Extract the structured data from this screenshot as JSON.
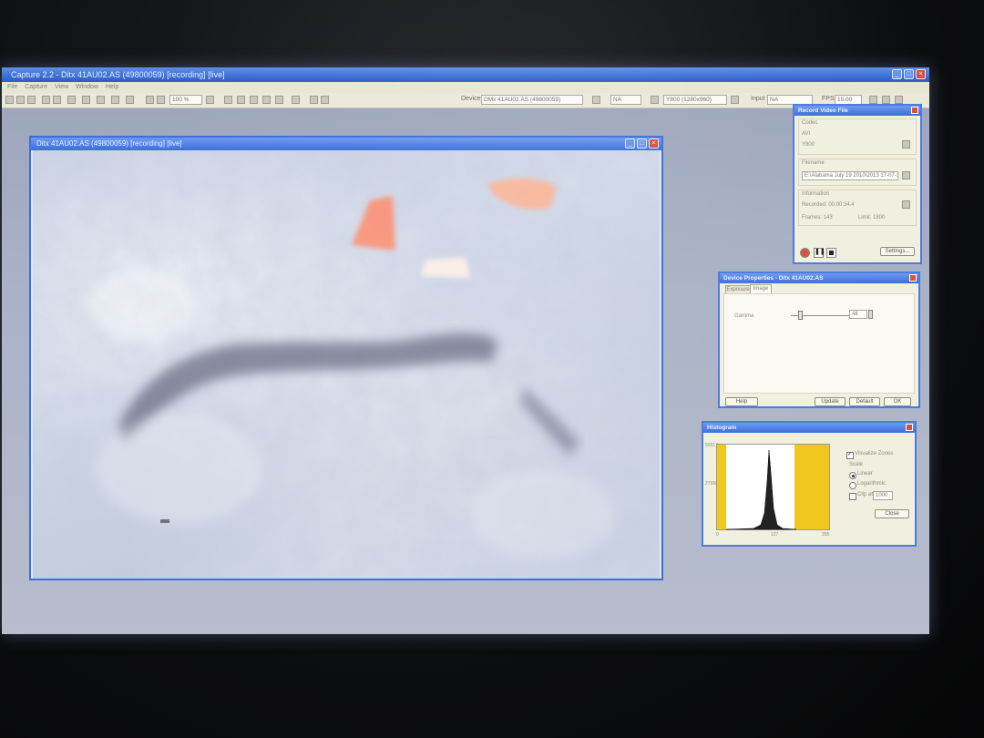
{
  "app": {
    "title": "Capture 2.2 - Ditx 41AU02.AS (49800059) [recording] [live]",
    "menu": [
      "File",
      "Capture",
      "View",
      "Window",
      "Help"
    ]
  },
  "toolbar": {
    "zoom": "100 %",
    "device_label": "Device",
    "device_value": "DMx 41AU02.AS (49800059)",
    "fmt_value": "NA",
    "resolution_value": "Y800 (1280x960)",
    "input_label": "Input",
    "input_value": "NA",
    "fps_label": "FPS",
    "fps_value": "15.00"
  },
  "video_window": {
    "title": "Ditx 41AU02.AS (49800059) [recording] [live]"
  },
  "record_panel": {
    "title": "Record Video File",
    "codec_label": "Codec",
    "codec_type": "AVI",
    "codec_value": "Y800",
    "filename_label": "Filename",
    "filename_value": "E:\\Alabama July 19 2010\\2013 17-07-19",
    "info_label": "Information",
    "recorded_label": "Recorded: 00:00:34.4",
    "frames_label": "Frames: 143",
    "limit_label": "Limit: 1800",
    "settings_label": "Settings..."
  },
  "device_panel": {
    "title": "Device Properties - Ditx 41AU02.AS",
    "tabs": [
      "Exposure",
      "Image"
    ],
    "active_tab": "Image",
    "gamma_label": "Gamma",
    "gamma_value": "48",
    "gamma_level": 0.1,
    "help_label": "Help",
    "update_label": "Update",
    "default_label": "Default",
    "ok_label": "OK"
  },
  "histogram_panel": {
    "title": "Histogram",
    "y_top": "55917",
    "y_mid": "27960",
    "x_left": "0",
    "x_mid": "127",
    "x_right": "255",
    "visualize_label": "Visualize Zones",
    "scale_label": "Scale",
    "linear_label": "Linear",
    "log_label": "Logarithmic",
    "clip_label": "Clip at",
    "clip_value": "1000",
    "close_label": "Close"
  },
  "colors": {
    "title_blue": "#3d6fd8",
    "zone_yellow": "#f2c71d",
    "record_red": "#d5533a"
  }
}
